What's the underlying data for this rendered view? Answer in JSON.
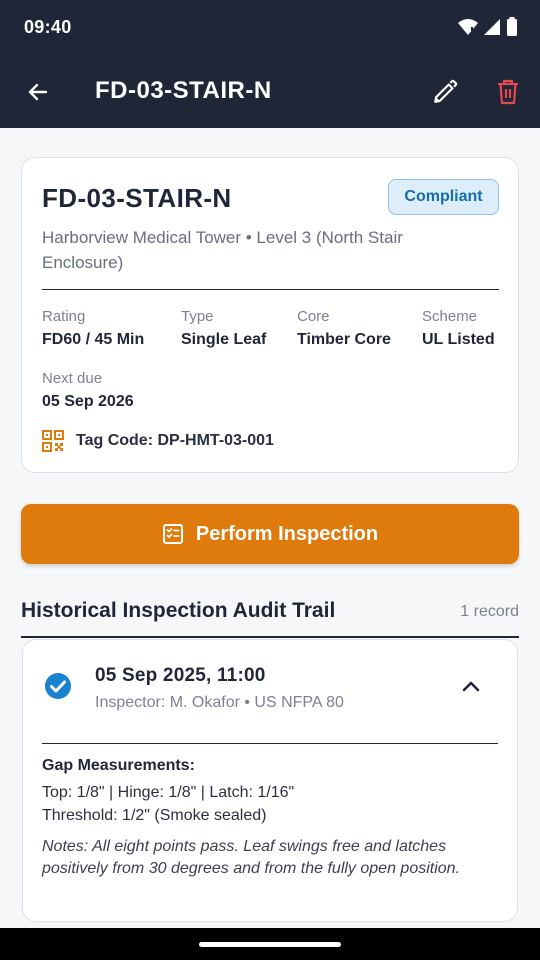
{
  "status_bar": {
    "time": "09:40"
  },
  "app_bar": {
    "title": "FD-03-STAIR-N"
  },
  "door": {
    "id": "FD-03-STAIR-N",
    "status": "Compliant",
    "location": "Harborview Medical Tower • Level 3 (North Stair Enclosure)",
    "specs": [
      {
        "label": "Rating",
        "value": "FD60 / 45 Min"
      },
      {
        "label": "Type",
        "value": "Single Leaf"
      },
      {
        "label": "Core",
        "value": "Timber Core"
      },
      {
        "label": "Scheme",
        "value": "UL Listed"
      }
    ],
    "next_due": {
      "label": "Next due",
      "value": "05 Sep 2026"
    },
    "tag_code": "Tag Code: DP-HMT-03-001"
  },
  "actions": {
    "perform_inspection": "Perform Inspection"
  },
  "audit": {
    "title": "Historical Inspection Audit Trail",
    "count": "1 record",
    "records": [
      {
        "date": "05 Sep 2025, 11:00",
        "inspector": "Inspector: M. Okafor • US NFPA 80",
        "gap_title": "Gap Measurements:",
        "gap_line1": "Top: 1/8\" | Hinge: 1/8\" | Latch: 1/16\"",
        "gap_line2": "Threshold: 1/2\" (Smoke sealed)",
        "notes": "Notes: All eight points pass. Leaf swings free and latches positively from 30 degrees and from the fully open position."
      }
    ]
  },
  "colors": {
    "app_bar": "#1e2638",
    "accent_orange": "#df7a0c",
    "delete_red": "#e5484d",
    "check_blue": "#1a80d0",
    "badge_text": "#166ea8"
  }
}
